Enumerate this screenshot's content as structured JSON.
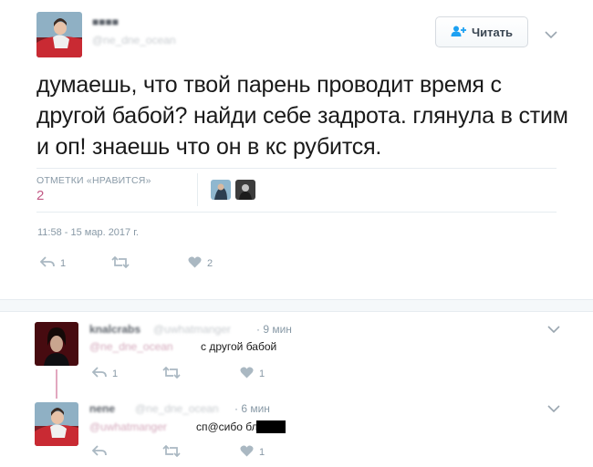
{
  "main_tweet": {
    "author_name": "■■■■",
    "author_handle": "@ne_dne_ocean",
    "follow_label": "Читать",
    "text": "думаешь, что твой парень проводит время с другой бабой? найди себе задрота. глянула в стим и оп! знаешь что он в кс рубится.",
    "likes_label": "ОТМЕТКИ «НРАВИТСЯ»",
    "likes_count": "2",
    "timestamp": "11:58 - 15 мар. 2017 г.",
    "reply_count": "1",
    "retweet_count": "",
    "like_count": "2"
  },
  "replies": [
    {
      "author_name": "knalcrabs",
      "author_handle": "@uwhatmanger",
      "time": "· 9 мин",
      "mention": "@ne_dne_ocean",
      "text": "с другой бабой",
      "reply_count": "1",
      "retweet_count": "",
      "like_count": "1"
    },
    {
      "author_name": "nene",
      "author_handle": "@ne_dne_ocean",
      "time": "· 6 мин",
      "mention": "@uwhatmanger",
      "text": "сп@сибо бл",
      "reply_count": "",
      "retweet_count": "",
      "like_count": "1"
    }
  ],
  "colors": {
    "accent_blue": "#1da1f2",
    "like_pink": "#c25985",
    "muted": "#8899a6"
  }
}
